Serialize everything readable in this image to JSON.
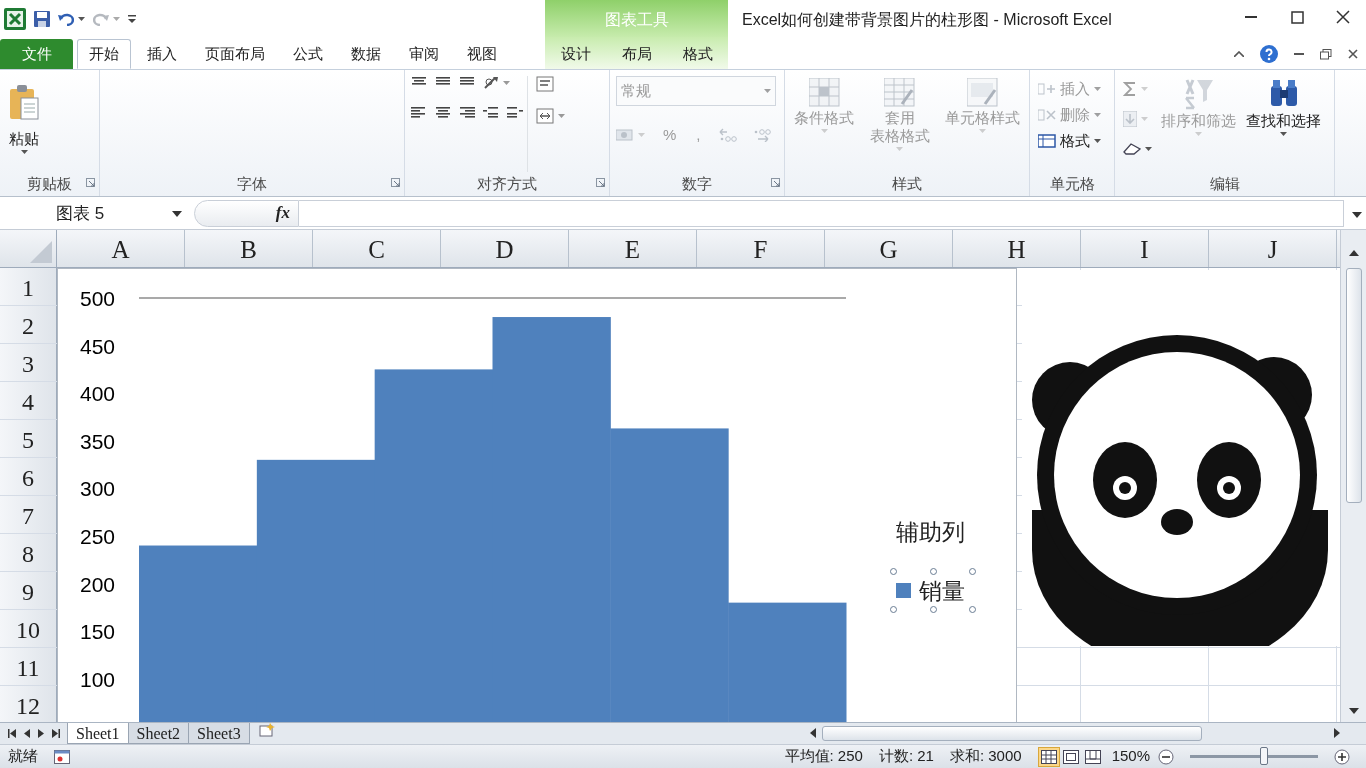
{
  "title_bar": {
    "context_label": "图表工具",
    "title": "Excel如何创建带背景图片的柱形图 - Microsoft Excel"
  },
  "tabs": [
    {
      "label": "文件",
      "kind": "file",
      "selected": false
    },
    {
      "label": "开始",
      "kind": "main",
      "selected": true
    },
    {
      "label": "插入",
      "kind": "main",
      "selected": false
    },
    {
      "label": "页面布局",
      "kind": "main",
      "selected": false
    },
    {
      "label": "公式",
      "kind": "main",
      "selected": false
    },
    {
      "label": "数据",
      "kind": "main",
      "selected": false
    },
    {
      "label": "审阅",
      "kind": "main",
      "selected": false
    },
    {
      "label": "视图",
      "kind": "main",
      "selected": false
    },
    {
      "label": "设计",
      "kind": "context",
      "selected": false
    },
    {
      "label": "布局",
      "kind": "context",
      "selected": false
    },
    {
      "label": "格式",
      "kind": "context",
      "selected": false
    }
  ],
  "ribbon": {
    "groups": [
      {
        "label": "剪贴板",
        "kind": "clipboard",
        "launcher": true,
        "buttons": [
          {
            "label": "粘贴",
            "disabled": false
          }
        ]
      },
      {
        "label": "字体",
        "kind": "font",
        "launcher": true
      },
      {
        "label": "对齐方式",
        "kind": "alignment",
        "launcher": true
      },
      {
        "label": "数字",
        "kind": "number",
        "launcher": true,
        "format": "常规",
        "format_disabled": true,
        "buttons": [
          {
            "label": "%",
            "disabled": true
          },
          {
            "label": ",",
            "disabled": true
          }
        ]
      },
      {
        "label": "样式",
        "kind": "styles",
        "buttons": [
          {
            "label_lines": [
              "条件格式"
            ],
            "disabled": true
          },
          {
            "label_lines": [
              "套用",
              "表格格式"
            ],
            "disabled": true
          },
          {
            "label_lines": [
              "单元格样式"
            ],
            "disabled": true
          }
        ]
      },
      {
        "label": "单元格",
        "kind": "cells",
        "buttons": [
          {
            "label": "插入",
            "disabled": true
          },
          {
            "label": "删除",
            "disabled": true
          },
          {
            "label": "格式",
            "disabled": false
          }
        ]
      },
      {
        "label": "编辑",
        "kind": "editing",
        "buttons": [
          {
            "label": "排序和筛选",
            "disabled": true
          },
          {
            "label": "查找和选择",
            "disabled": false
          }
        ]
      }
    ]
  },
  "formula_bar": {
    "name_box": "图表 5",
    "function_label": "fx"
  },
  "columns": [
    "A",
    "B",
    "C",
    "D",
    "E",
    "F",
    "G",
    "H",
    "I",
    "J"
  ],
  "rows": [
    "1",
    "2",
    "3",
    "4",
    "5",
    "6",
    "7",
    "8",
    "9",
    "10",
    "11",
    "12"
  ],
  "chart": {
    "chart_data": {
      "type": "bar",
      "ylim": [
        0,
        500
      ],
      "yticks": [
        100,
        150,
        200,
        250,
        300,
        350,
        400,
        450,
        500
      ],
      "series": [
        {
          "name": "销量",
          "color": "#4f81bd",
          "values": [
            240,
            330,
            425,
            480,
            363,
            180
          ]
        }
      ]
    },
    "legend": [
      {
        "kind": "text",
        "label": "辅助列",
        "selected": false
      },
      {
        "kind": "series",
        "selected": true
      }
    ]
  },
  "sheet_tabs": [
    {
      "label": "Sheet1",
      "selected": true
    },
    {
      "label": "Sheet2",
      "selected": false
    },
    {
      "label": "Sheet3",
      "selected": false
    }
  ],
  "status_bar": {
    "mode": "就绪",
    "stats": [
      "平均值: 250",
      "计数: 21",
      "求和: 3000"
    ],
    "views": [
      {
        "kind": "normal",
        "selected": true
      },
      {
        "kind": "layout",
        "selected": false
      },
      {
        "kind": "pagebreak",
        "selected": false
      }
    ],
    "zoom": "150%",
    "zoom_slider": {
      "level": 0.58
    }
  }
}
